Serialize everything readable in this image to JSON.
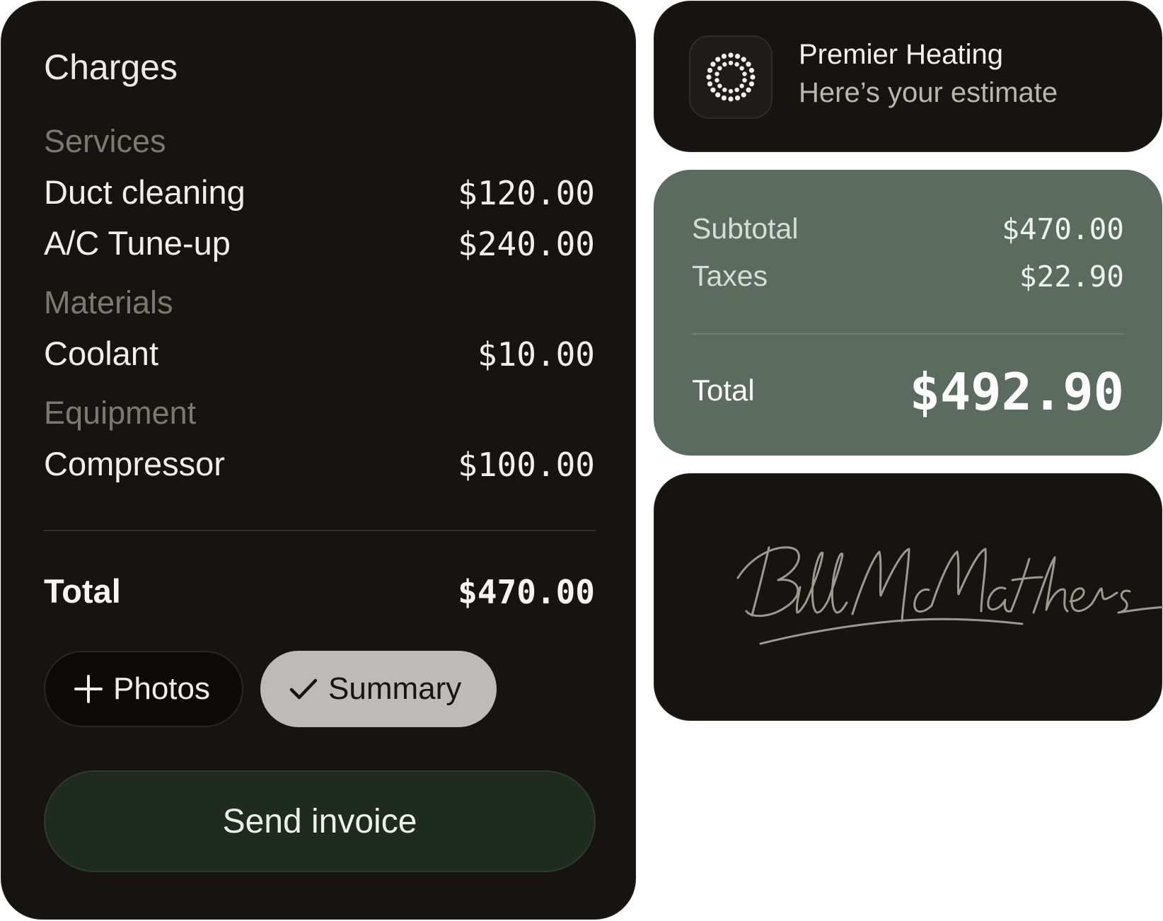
{
  "charges": {
    "title": "Charges",
    "sections": [
      {
        "label": "Services",
        "items": [
          {
            "name": "Duct cleaning",
            "price": "$120.00"
          },
          {
            "name": "A/C Tune-up",
            "price": "$240.00"
          }
        ]
      },
      {
        "label": "Materials",
        "items": [
          {
            "name": "Coolant",
            "price": "$10.00"
          }
        ]
      },
      {
        "label": "Equipment",
        "items": [
          {
            "name": "Compressor",
            "price": "$100.00"
          }
        ]
      }
    ],
    "total_label": "Total",
    "total_value": "$470.00",
    "photos_label": "Photos",
    "summary_label": "Summary",
    "send_label": "Send invoice"
  },
  "header": {
    "company": "Premier Heating",
    "subtitle": "Here’s your estimate",
    "logo_icon": "dotted-circle-logo-icon"
  },
  "summary": {
    "subtotal_label": "Subtotal",
    "subtotal_value": "$470.00",
    "taxes_label": "Taxes",
    "taxes_value": "$22.90",
    "total_label": "Total",
    "total_value": "$492.90"
  },
  "signature": {
    "signer": "Bill McMathers"
  },
  "colors": {
    "card_dark": "#161311",
    "summary_green": "#5b6b60",
    "send_button": "#1f2b21",
    "summary_chip": "#bdbbb8"
  }
}
